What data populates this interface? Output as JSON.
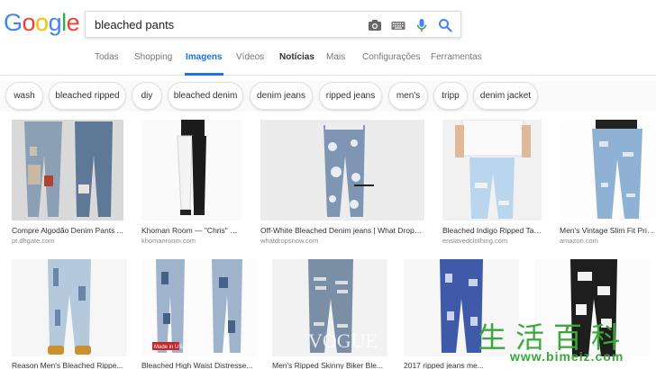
{
  "header": {
    "logo_letters": [
      "G",
      "o",
      "o",
      "g",
      "l",
      "e"
    ],
    "logo_colors": [
      "#4285f4",
      "#ea4335",
      "#fbbc05",
      "#4285f4",
      "#34a853",
      "#ea4335"
    ],
    "search_query": "bleached pants",
    "icons": [
      "camera-icon",
      "keyboard-icon",
      "microphone-icon",
      "search-icon"
    ]
  },
  "tabs": [
    {
      "label": "Todas"
    },
    {
      "label": "Shopping"
    },
    {
      "label": "Imagens"
    },
    {
      "label": "Vídeos"
    },
    {
      "label": "Notícias"
    },
    {
      "label": "Mais"
    },
    {
      "label": "Configurações"
    },
    {
      "label": "Ferramentas"
    }
  ],
  "active_tab": "Imagens",
  "chips": [
    "wash",
    "bleached ripped",
    "diy",
    "bleached denim",
    "denim jeans",
    "ripped jeans",
    "men's",
    "tripp",
    "denim jacket"
  ],
  "results_row1": [
    {
      "caption": "Compre Algodão Denim Pants ...",
      "source": "pt.dhgate.com"
    },
    {
      "caption": "Khoman Room — \"Chris\" Bl...",
      "source": "khomanroom.com"
    },
    {
      "caption": "Off-White Bleached Denim jeans | What Drops ...",
      "source": "whatdropsnow.com"
    },
    {
      "caption": "Bleached Indigo Ripped Tap...",
      "source": "enslavedclothing.com"
    },
    {
      "caption": "Men's Vintage Slim Fit Print...",
      "source": "amazon.com"
    }
  ],
  "results_row2": [
    {
      "caption": "Reason Men's Bleached Rippe..."
    },
    {
      "caption": "Bleached High Waist Distresse..."
    },
    {
      "caption": "Men's Ripped Skinny Biker Ble..."
    },
    {
      "caption": "2017 ripped jeans me..."
    }
  ],
  "image_overlays": {
    "made_in_usa": "Made in USA",
    "vogue": "VOGUE"
  },
  "watermark": {
    "chars": "生活百科",
    "url": "www.bimeiz.com"
  }
}
